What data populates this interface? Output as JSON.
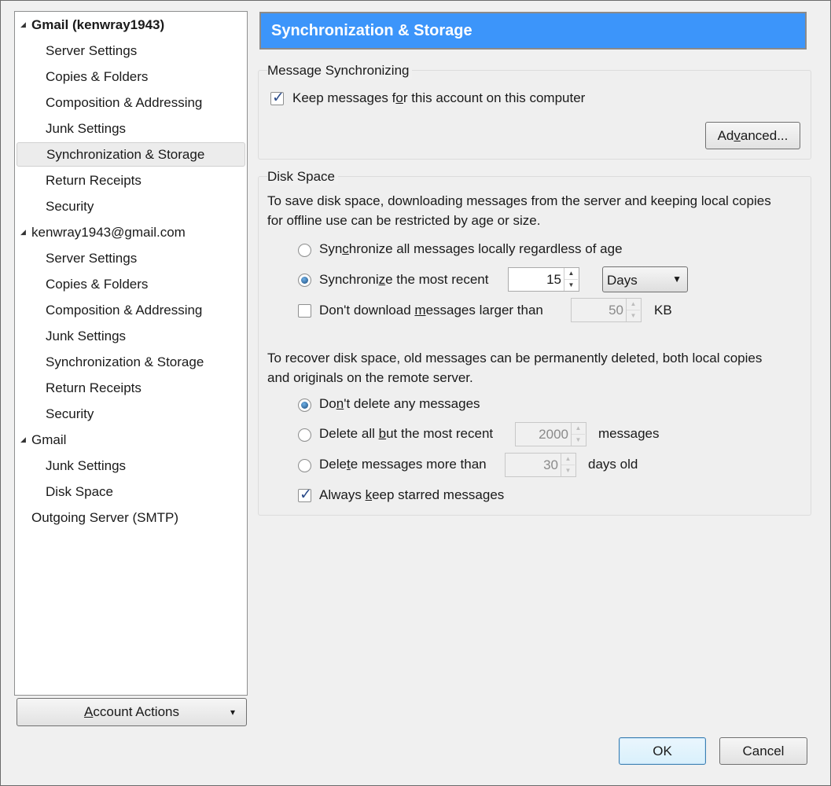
{
  "tree": {
    "items": [
      {
        "label": "Gmail (kenwray1943)",
        "level": 0,
        "twisty": true,
        "bold": true
      },
      {
        "label": "Server Settings",
        "level": 1
      },
      {
        "label": "Copies & Folders",
        "level": 1
      },
      {
        "label": "Composition & Addressing",
        "level": 1
      },
      {
        "label": "Junk Settings",
        "level": 1
      },
      {
        "label": "Synchronization & Storage",
        "level": 1,
        "selected": true
      },
      {
        "label": "Return Receipts",
        "level": 1
      },
      {
        "label": "Security",
        "level": 1
      },
      {
        "label": "kenwray1943@gmail.com",
        "level": 0,
        "twisty": true
      },
      {
        "label": "Server Settings",
        "level": 1
      },
      {
        "label": "Copies & Folders",
        "level": 1
      },
      {
        "label": "Composition & Addressing",
        "level": 1
      },
      {
        "label": "Junk Settings",
        "level": 1
      },
      {
        "label": "Synchronization & Storage",
        "level": 1
      },
      {
        "label": "Return Receipts",
        "level": 1
      },
      {
        "label": "Security",
        "level": 1
      },
      {
        "label": "Gmail",
        "level": 0,
        "twisty": true
      },
      {
        "label": "Junk Settings",
        "level": 1
      },
      {
        "label": "Disk Space",
        "level": 1
      },
      {
        "label": "Outgoing Server (SMTP)",
        "level": 0
      }
    ]
  },
  "account_actions": {
    "label_u": "A",
    "label_rest": "ccount Actions",
    "arrow": "▾"
  },
  "header": {
    "title": "Synchronization & Storage"
  },
  "msg_sync": {
    "caption": "Message Synchronizing",
    "keep_messages": {
      "pre": "Keep messages f",
      "u": "o",
      "post": "r this account on this computer",
      "checked": true
    },
    "advanced": {
      "pre": "Ad",
      "u": "v",
      "post": "anced..."
    }
  },
  "disk_space": {
    "caption": "Disk Space",
    "intro_line1": "To save disk space, downloading messages from the server and keeping local copies",
    "intro_line2": "for offline use can be restricted by age or size.",
    "sync_all": {
      "pre": "Syn",
      "u": "c",
      "post": "hronize all messages locally regardless of age",
      "selected": false
    },
    "sync_recent": {
      "pre": "Synchroni",
      "u": "z",
      "post": "e the most recent",
      "selected": true,
      "value": "15"
    },
    "period": {
      "selected": "Days",
      "arrow": "▼"
    },
    "dont_download": {
      "pre": "Don't download ",
      "u": "m",
      "post": "essages larger than",
      "checked": false,
      "value": "50",
      "unit": "KB"
    },
    "recover_line1": "To recover disk space, old messages can be permanently deleted, both local copies",
    "recover_line2": "and originals on the remote server.",
    "dont_delete": {
      "pre": "Do",
      "u": "n",
      "post": "'t delete any messages",
      "selected": true
    },
    "delete_all_but": {
      "pre": "Delete all ",
      "u": "b",
      "post": "ut the most recent",
      "selected": false,
      "value": "2000",
      "unit": "messages"
    },
    "delete_older": {
      "pre": "Dele",
      "u": "t",
      "post": "e messages more than",
      "selected": false,
      "value": "30",
      "unit": "days old"
    },
    "keep_starred": {
      "pre": "Always ",
      "u": "k",
      "post": "eep starred messages",
      "checked": true
    }
  },
  "footer": {
    "ok": "OK",
    "cancel": "Cancel"
  },
  "icons": {
    "check": "✓",
    "spin_up": "▲",
    "spin_down": "▼",
    "twisty": "◢"
  },
  "colors": {
    "header_bg": "#3c95fa",
    "header_text": "#ffffff"
  }
}
